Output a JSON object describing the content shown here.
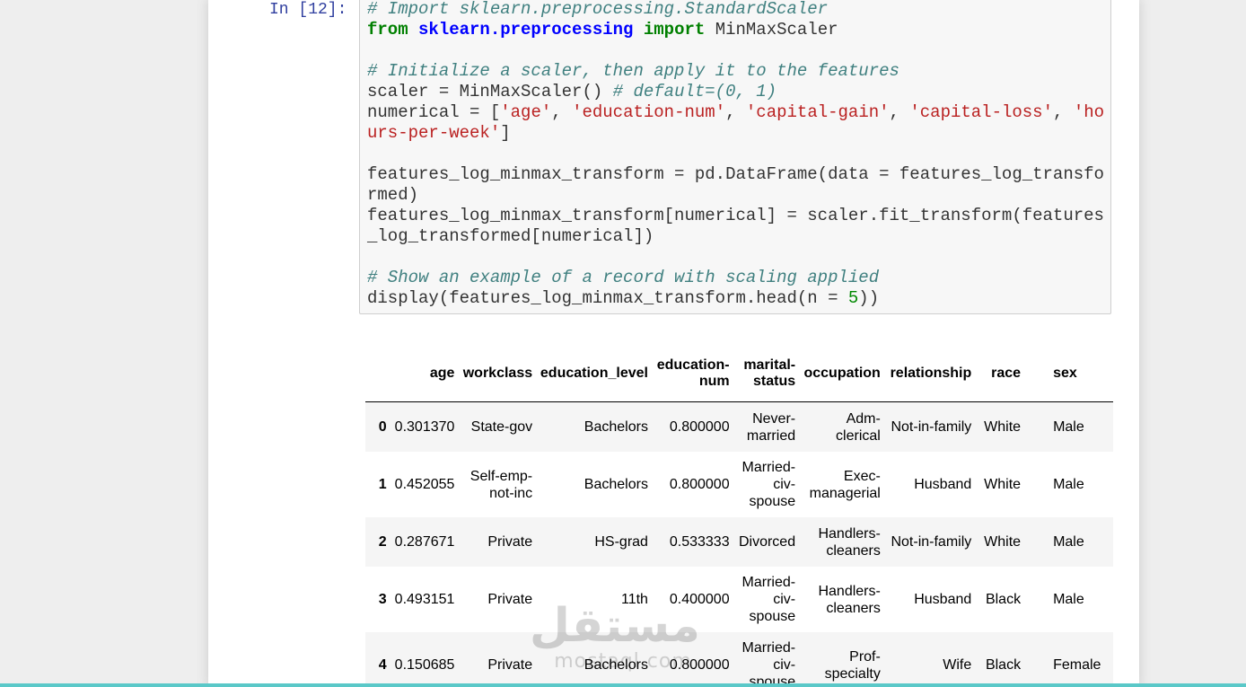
{
  "cell": {
    "prompt": "In [12]:",
    "code_lines": [
      [
        {
          "t": "comment",
          "v": "# Import sklearn.preprocessing.StandardScaler"
        }
      ],
      [
        {
          "t": "keyword",
          "v": "from"
        },
        {
          "t": "plain",
          "v": " "
        },
        {
          "t": "module",
          "v": "sklearn.preprocessing"
        },
        {
          "t": "plain",
          "v": " "
        },
        {
          "t": "keyword",
          "v": "import"
        },
        {
          "t": "plain",
          "v": " MinMaxScaler"
        }
      ],
      [],
      [
        {
          "t": "comment",
          "v": "# Initialize a scaler, then apply it to the features"
        }
      ],
      [
        {
          "t": "plain",
          "v": "scaler = MinMaxScaler() "
        },
        {
          "t": "comment",
          "v": "# default=(0, 1)"
        }
      ],
      [
        {
          "t": "plain",
          "v": "numerical = ["
        },
        {
          "t": "string",
          "v": "'age'"
        },
        {
          "t": "plain",
          "v": ", "
        },
        {
          "t": "string",
          "v": "'education-num'"
        },
        {
          "t": "plain",
          "v": ", "
        },
        {
          "t": "string",
          "v": "'capital-gain'"
        },
        {
          "t": "plain",
          "v": ", "
        },
        {
          "t": "string",
          "v": "'capital-loss'"
        },
        {
          "t": "plain",
          "v": ", "
        },
        {
          "t": "string",
          "v": "'ho"
        }
      ],
      [
        {
          "t": "string",
          "v": "urs-per-week'"
        },
        {
          "t": "plain",
          "v": "]"
        }
      ],
      [],
      [
        {
          "t": "plain",
          "v": "features_log_minmax_transform = pd.DataFrame(data = features_log_transfo"
        }
      ],
      [
        {
          "t": "plain",
          "v": "rmed)"
        }
      ],
      [
        {
          "t": "plain",
          "v": "features_log_minmax_transform[numerical] = scaler.fit_transform(features"
        }
      ],
      [
        {
          "t": "plain",
          "v": "_log_transformed[numerical])"
        }
      ],
      [],
      [
        {
          "t": "comment",
          "v": "# Show an example of a record with scaling applied"
        }
      ],
      [
        {
          "t": "plain",
          "v": "display(features_log_minmax_transform.head(n = "
        },
        {
          "t": "number",
          "v": "5"
        },
        {
          "t": "plain",
          "v": "))"
        }
      ]
    ]
  },
  "table": {
    "columns": [
      "",
      "age",
      "workclass",
      "education_level",
      "education-num",
      "marital-status",
      "occupation",
      "relationship",
      "race",
      "sex"
    ],
    "rows": [
      [
        "0",
        "0.301370",
        "State-gov",
        "Bachelors",
        "0.800000",
        "Never-married",
        "Adm-clerical",
        "Not-in-family",
        "White",
        "Male"
      ],
      [
        "1",
        "0.452055",
        "Self-emp-not-inc",
        "Bachelors",
        "0.800000",
        "Married-civ-spouse",
        "Exec-managerial",
        "Husband",
        "White",
        "Male"
      ],
      [
        "2",
        "0.287671",
        "Private",
        "HS-grad",
        "0.533333",
        "Divorced",
        "Handlers-cleaners",
        "Not-in-family",
        "White",
        "Male"
      ],
      [
        "3",
        "0.493151",
        "Private",
        "11th",
        "0.400000",
        "Married-civ-spouse",
        "Handlers-cleaners",
        "Husband",
        "Black",
        "Male"
      ],
      [
        "4",
        "0.150685",
        "Private",
        "Bachelors",
        "0.800000",
        "Married-civ-spouse",
        "Prof-specialty",
        "Wife",
        "Black",
        "Female"
      ]
    ]
  },
  "watermark": {
    "arabic": "مستقل",
    "latin": "mostaql.com"
  }
}
